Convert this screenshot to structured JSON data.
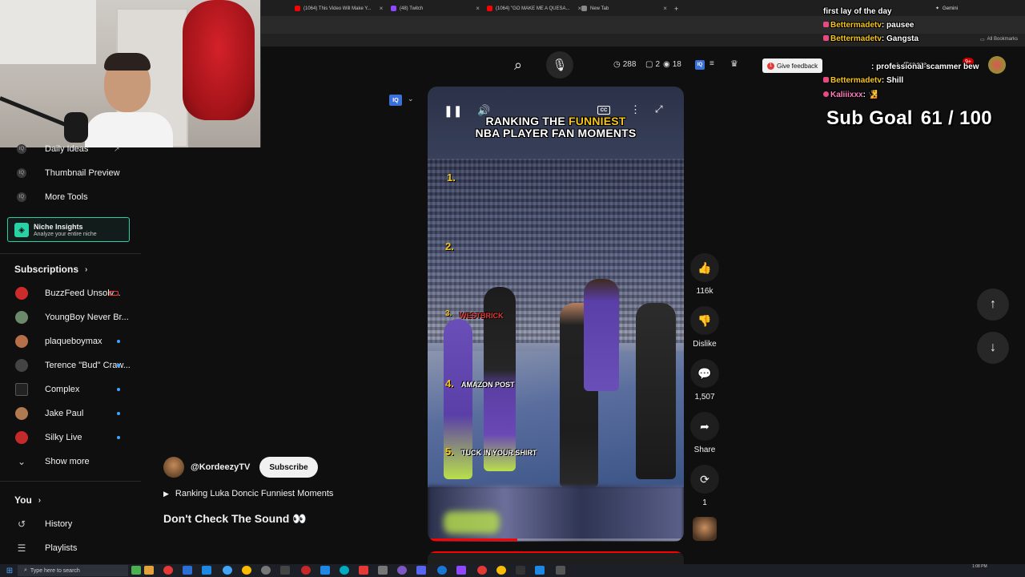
{
  "browser": {
    "tabs": [
      {
        "title": "(1064) This Video Will Make Y...",
        "favicon_color": "#ff0000"
      },
      {
        "title": "(48) Twitch",
        "favicon_color": "#9146ff"
      },
      {
        "title": "(1064) \"GO MAKE ME A QUESA...",
        "favicon_color": "#ff0000"
      },
      {
        "title": "New Tab",
        "favicon_color": "#888888"
      }
    ],
    "new_tab_symbol": "+",
    "bookmarks_label": "All Bookmarks",
    "gemini_label": "Gemini"
  },
  "header": {
    "stats": {
      "views": "288",
      "comments": "2",
      "viewers": "18"
    },
    "iq_label": "IQ",
    "feedback_label": "Give feedback",
    "create_label": "Create",
    "notif_count": "9+"
  },
  "sidebar": {
    "tools": [
      {
        "label": "Daily Ideas",
        "icon": "iq-icon"
      },
      {
        "label": "Thumbnail Preview",
        "icon": "iq-icon"
      },
      {
        "label": "More Tools",
        "icon": "iq-icon"
      }
    ],
    "niche": {
      "title": "Niche Insights",
      "subtitle": "Analyze your entire niche"
    },
    "subscriptions_title": "Subscriptions",
    "subscriptions": [
      {
        "name": "BuzzFeed Unsolv...",
        "color": "#cc2b2b",
        "live": false
      },
      {
        "name": "YoungBoy Never Br...",
        "color": "#6a8a6a",
        "live": false
      },
      {
        "name": "plaqueboymax",
        "color": "#b5704a",
        "live": true
      },
      {
        "name": "Terence \"Bud\" Craw...",
        "color": "#444444",
        "live": true
      },
      {
        "name": "Complex",
        "color": "#222222",
        "live": true
      },
      {
        "name": "Jake Paul",
        "color": "#b07a50",
        "live": true
      },
      {
        "name": "Silky Live",
        "color": "#c42a2a",
        "live": true
      }
    ],
    "show_more": "Show more",
    "you_title": "You",
    "you_items": [
      {
        "label": "History"
      },
      {
        "label": "Playlists"
      }
    ]
  },
  "short": {
    "overlay_title_line1_a": "RANKING THE ",
    "overlay_title_line1_b": "FUNNIEST",
    "overlay_title_line2": "NBA PLAYER FAN MOMENTS",
    "ranks": [
      {
        "num": "1.",
        "label": ""
      },
      {
        "num": "2.",
        "label": ""
      },
      {
        "num": "3.",
        "label": "WESTBRICK",
        "color": "#e53935"
      },
      {
        "num": "4.",
        "label": "AMAZON POST",
        "color": "#ffffff"
      },
      {
        "num": "5.",
        "label": "TUCK IN YOUR SHIRT",
        "color": "#ffffff"
      }
    ],
    "progress": 0.35,
    "cc_label": "CC",
    "channel": "@KordeezyTV",
    "subscribe_label": "Subscribe",
    "related_label": "Ranking Luka Doncic Funniest Moments",
    "title": "Don't Check The Sound 👀"
  },
  "actions": [
    {
      "name": "like",
      "icon": "👍",
      "caption": "116k"
    },
    {
      "name": "dislike",
      "icon": "👎",
      "caption": "Dislike"
    },
    {
      "name": "comments",
      "icon": "💬",
      "caption": "1,507"
    },
    {
      "name": "share",
      "icon": "➦",
      "caption": "Share"
    },
    {
      "name": "remix",
      "icon": "⟳",
      "caption": "1"
    }
  ],
  "chat": [
    {
      "user": "",
      "message": "first lay of the day"
    },
    {
      "user": "Bettermadetv",
      "message": ": pausee"
    },
    {
      "user": "Bettermadetv",
      "message": ": Gangsta"
    },
    {
      "user": "",
      "message": ": professional scammer bew"
    },
    {
      "user": "Bettermadetv",
      "message": ": Shill"
    },
    {
      "user": "Kaliiixxx",
      "message": ": 🧏"
    }
  ],
  "sub_goal": {
    "label": "Sub Goal",
    "current": "61",
    "sep": "/",
    "target": "100"
  },
  "taskbar": {
    "search_placeholder": "Type here to search",
    "time": "1:08 PM"
  },
  "colors": {
    "accent_red": "#ff0000",
    "niche_teal": "#2ad1a5",
    "live_blue": "#3ea6ff",
    "rank_yellow": "#f5c518"
  }
}
